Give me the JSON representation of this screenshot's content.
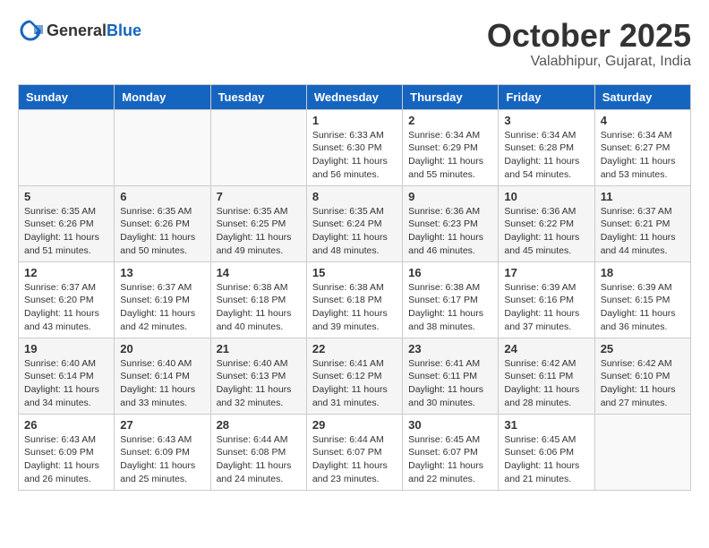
{
  "header": {
    "logo_general": "General",
    "logo_blue": "Blue",
    "month": "October 2025",
    "location": "Valabhipur, Gujarat, India"
  },
  "weekdays": [
    "Sunday",
    "Monday",
    "Tuesday",
    "Wednesday",
    "Thursday",
    "Friday",
    "Saturday"
  ],
  "weeks": [
    [
      {
        "day": "",
        "info": ""
      },
      {
        "day": "",
        "info": ""
      },
      {
        "day": "",
        "info": ""
      },
      {
        "day": "1",
        "info": "Sunrise: 6:33 AM\nSunset: 6:30 PM\nDaylight: 11 hours\nand 56 minutes."
      },
      {
        "day": "2",
        "info": "Sunrise: 6:34 AM\nSunset: 6:29 PM\nDaylight: 11 hours\nand 55 minutes."
      },
      {
        "day": "3",
        "info": "Sunrise: 6:34 AM\nSunset: 6:28 PM\nDaylight: 11 hours\nand 54 minutes."
      },
      {
        "day": "4",
        "info": "Sunrise: 6:34 AM\nSunset: 6:27 PM\nDaylight: 11 hours\nand 53 minutes."
      }
    ],
    [
      {
        "day": "5",
        "info": "Sunrise: 6:35 AM\nSunset: 6:26 PM\nDaylight: 11 hours\nand 51 minutes."
      },
      {
        "day": "6",
        "info": "Sunrise: 6:35 AM\nSunset: 6:26 PM\nDaylight: 11 hours\nand 50 minutes."
      },
      {
        "day": "7",
        "info": "Sunrise: 6:35 AM\nSunset: 6:25 PM\nDaylight: 11 hours\nand 49 minutes."
      },
      {
        "day": "8",
        "info": "Sunrise: 6:35 AM\nSunset: 6:24 PM\nDaylight: 11 hours\nand 48 minutes."
      },
      {
        "day": "9",
        "info": "Sunrise: 6:36 AM\nSunset: 6:23 PM\nDaylight: 11 hours\nand 46 minutes."
      },
      {
        "day": "10",
        "info": "Sunrise: 6:36 AM\nSunset: 6:22 PM\nDaylight: 11 hours\nand 45 minutes."
      },
      {
        "day": "11",
        "info": "Sunrise: 6:37 AM\nSunset: 6:21 PM\nDaylight: 11 hours\nand 44 minutes."
      }
    ],
    [
      {
        "day": "12",
        "info": "Sunrise: 6:37 AM\nSunset: 6:20 PM\nDaylight: 11 hours\nand 43 minutes."
      },
      {
        "day": "13",
        "info": "Sunrise: 6:37 AM\nSunset: 6:19 PM\nDaylight: 11 hours\nand 42 minutes."
      },
      {
        "day": "14",
        "info": "Sunrise: 6:38 AM\nSunset: 6:18 PM\nDaylight: 11 hours\nand 40 minutes."
      },
      {
        "day": "15",
        "info": "Sunrise: 6:38 AM\nSunset: 6:18 PM\nDaylight: 11 hours\nand 39 minutes."
      },
      {
        "day": "16",
        "info": "Sunrise: 6:38 AM\nSunset: 6:17 PM\nDaylight: 11 hours\nand 38 minutes."
      },
      {
        "day": "17",
        "info": "Sunrise: 6:39 AM\nSunset: 6:16 PM\nDaylight: 11 hours\nand 37 minutes."
      },
      {
        "day": "18",
        "info": "Sunrise: 6:39 AM\nSunset: 6:15 PM\nDaylight: 11 hours\nand 36 minutes."
      }
    ],
    [
      {
        "day": "19",
        "info": "Sunrise: 6:40 AM\nSunset: 6:14 PM\nDaylight: 11 hours\nand 34 minutes."
      },
      {
        "day": "20",
        "info": "Sunrise: 6:40 AM\nSunset: 6:14 PM\nDaylight: 11 hours\nand 33 minutes."
      },
      {
        "day": "21",
        "info": "Sunrise: 6:40 AM\nSunset: 6:13 PM\nDaylight: 11 hours\nand 32 minutes."
      },
      {
        "day": "22",
        "info": "Sunrise: 6:41 AM\nSunset: 6:12 PM\nDaylight: 11 hours\nand 31 minutes."
      },
      {
        "day": "23",
        "info": "Sunrise: 6:41 AM\nSunset: 6:11 PM\nDaylight: 11 hours\nand 30 minutes."
      },
      {
        "day": "24",
        "info": "Sunrise: 6:42 AM\nSunset: 6:11 PM\nDaylight: 11 hours\nand 28 minutes."
      },
      {
        "day": "25",
        "info": "Sunrise: 6:42 AM\nSunset: 6:10 PM\nDaylight: 11 hours\nand 27 minutes."
      }
    ],
    [
      {
        "day": "26",
        "info": "Sunrise: 6:43 AM\nSunset: 6:09 PM\nDaylight: 11 hours\nand 26 minutes."
      },
      {
        "day": "27",
        "info": "Sunrise: 6:43 AM\nSunset: 6:09 PM\nDaylight: 11 hours\nand 25 minutes."
      },
      {
        "day": "28",
        "info": "Sunrise: 6:44 AM\nSunset: 6:08 PM\nDaylight: 11 hours\nand 24 minutes."
      },
      {
        "day": "29",
        "info": "Sunrise: 6:44 AM\nSunset: 6:07 PM\nDaylight: 11 hours\nand 23 minutes."
      },
      {
        "day": "30",
        "info": "Sunrise: 6:45 AM\nSunset: 6:07 PM\nDaylight: 11 hours\nand 22 minutes."
      },
      {
        "day": "31",
        "info": "Sunrise: 6:45 AM\nSunset: 6:06 PM\nDaylight: 11 hours\nand 21 minutes."
      },
      {
        "day": "",
        "info": ""
      }
    ]
  ]
}
